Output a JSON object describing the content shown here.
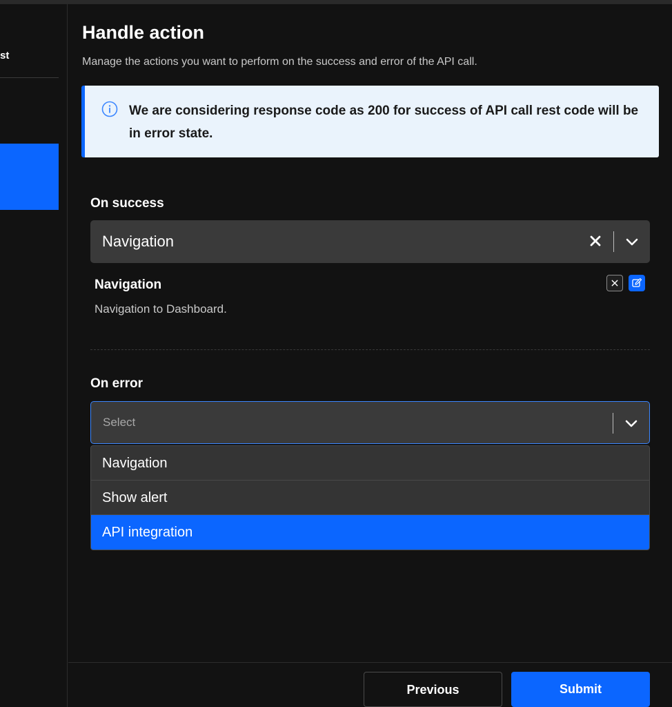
{
  "sidebar": {
    "step_label": "st"
  },
  "header": {
    "title": "Handle action",
    "subtitle": "Manage the actions you want to perform on the success and error of the API call."
  },
  "info_banner": {
    "text": "We are considering response code as 200 for success of API call rest code will be in error state."
  },
  "on_success": {
    "label": "On success",
    "selected_value": "Navigation",
    "action": {
      "title": "Navigation",
      "description": "Navigation to Dashboard."
    }
  },
  "on_error": {
    "label": "On error",
    "placeholder": "Select",
    "options": [
      {
        "label": "Navigation",
        "selected": false
      },
      {
        "label": "Show alert",
        "selected": false
      },
      {
        "label": "API integration",
        "selected": true
      }
    ]
  },
  "footer": {
    "previous_label": "Previous",
    "submit_label": "Submit"
  },
  "colors": {
    "accent": "#0b66ff",
    "background": "#121212",
    "info_bg": "#eaf3fc"
  },
  "icons": {
    "info": "info-icon",
    "clear": "close-icon",
    "dropdown": "chevron-down-icon",
    "edit": "edit-icon"
  }
}
